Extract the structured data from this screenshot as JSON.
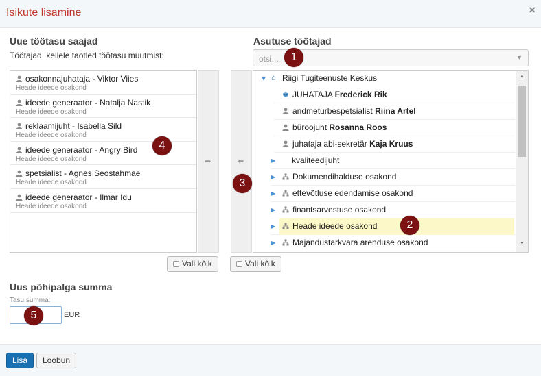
{
  "dialog": {
    "title": "Isikute lisamine",
    "close": "×"
  },
  "left": {
    "heading": "Uue töötasu saajad",
    "subtext": "Töötajad, kellele taotled töötasu muutmist:",
    "items": [
      {
        "label": "osakonnajuhataja - Viktor Viies",
        "sub": "Heade ideede osakond"
      },
      {
        "label": "ideede generaator - Natalja Nastik",
        "sub": "Heade ideede osakond"
      },
      {
        "label": "reklaamijuht - Isabella Sild",
        "sub": "Heade ideede osakond"
      },
      {
        "label": "ideede generaator - Angry Bird",
        "sub": "Heade ideede osakond"
      },
      {
        "label": "spetsialist - Agnes Seostahmae",
        "sub": "Heade ideede osakond"
      },
      {
        "label": "ideede generaator - Ilmar Idu",
        "sub": "Heade ideede osakond"
      }
    ],
    "select_all": "Vali kõik"
  },
  "transfer": {
    "right_arrow": "➡",
    "left_arrow": "⬅"
  },
  "right": {
    "heading": "Asutuse töötajad",
    "search_placeholder": "otsi...",
    "tree": {
      "root": "Riigi Tugiteenuste Keskus",
      "people": [
        {
          "role": "JUHATAJA",
          "name": "Frederick Rik"
        },
        {
          "role": "andmeturbespetsialist",
          "name": "Riina Artel"
        },
        {
          "role": "büroojuht",
          "name": "Rosanna Roos"
        },
        {
          "role": "juhataja abi-sekretär",
          "name": "Kaja Kruus"
        }
      ],
      "kvaliteedijuht": "kvaliteedijuht",
      "departments": [
        "Dokumendihalduse osakond",
        "ettevõtluse edendamise osakond",
        "finantsarvestuse osakond",
        "Heade ideede osakond",
        "Majandustarkvara arenduse osakond"
      ]
    },
    "select_all": "Vali kõik"
  },
  "salary": {
    "heading": "Uus põhipalga summa",
    "label": "Tasu summa:",
    "currency": "EUR",
    "value": ""
  },
  "footer": {
    "add": "Lisa",
    "cancel": "Loobun"
  },
  "badges": [
    "1",
    "2",
    "3",
    "4",
    "5"
  ],
  "colors": {
    "accent": "#1a6fb0",
    "title": "#c0392b",
    "highlight": "#fdf8c8",
    "badge": "#7b1111"
  }
}
